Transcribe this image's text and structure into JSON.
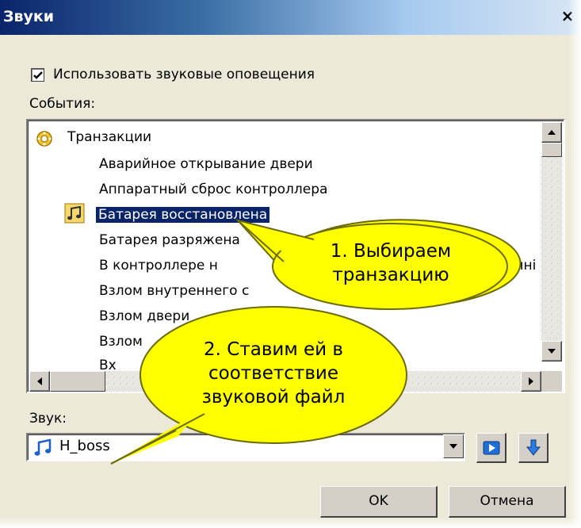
{
  "window": {
    "title": "Звуки",
    "close_glyph": "×"
  },
  "options": {
    "use_sounds_label": "Использовать звуковые оповещения",
    "use_sounds_checked": true
  },
  "events": {
    "label": "События:",
    "root": "Транзакции",
    "items": [
      "Аварийное открывание двери",
      "Аппаратный сброс контроллера",
      "Батарея восстановлена",
      "Батарея разряжена",
      "В контроллере н",
      "Взлом внутреннего с",
      "Взлом двери",
      "Взлом",
      "Вх"
    ],
    "selected_index": 2,
    "partial_tail": "анні"
  },
  "sound": {
    "label": "Звук:",
    "value": "H_boss"
  },
  "buttons": {
    "ok": "OK",
    "cancel": "Отмена"
  },
  "callouts": {
    "step1": [
      "1. Выбираем",
      "транзакцию"
    ],
    "step2": [
      "2. Ставим ей в",
      "соответствие",
      "звуковой файл"
    ]
  },
  "colors": {
    "selection": "#0a246a",
    "callout_fill": "#ffff00",
    "callout_stroke": "#6b6b00"
  }
}
